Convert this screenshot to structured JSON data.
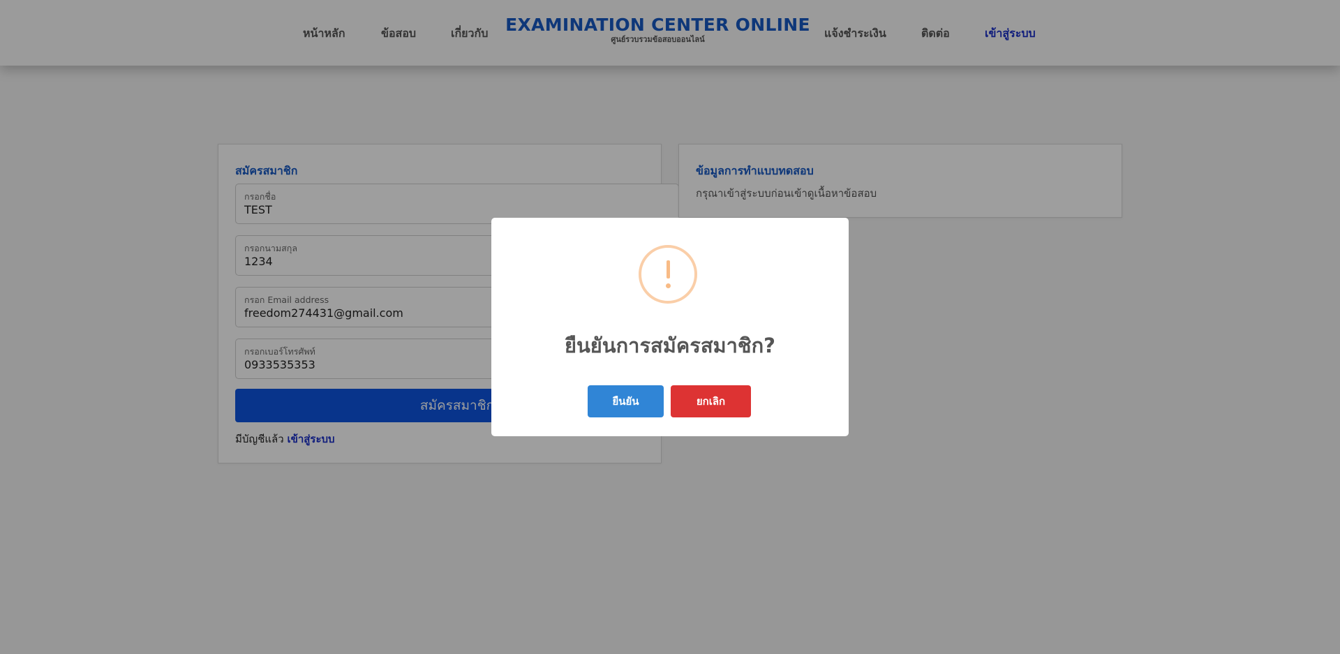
{
  "nav": {
    "items": [
      "หน้าหลัก",
      "ข้อสอบ",
      "เกี่ยวกับ",
      "แจ้งชำระเงิน",
      "ติดต่อ"
    ],
    "login": "เข้าสู่ระบบ"
  },
  "brand": {
    "title": "EXAMINATION CENTER ONLINE",
    "subtitle": "ศูนย์รวบรวมข้อสอบออนไลน์"
  },
  "register": {
    "title": "สมัครสมาชิก",
    "fields": [
      {
        "label": "กรอกชื่อ",
        "value": "TEST"
      },
      {
        "label": "กรอกนามสกุล",
        "value": "1234"
      },
      {
        "label": "กรอก Email address",
        "value": "freedom274431@gmail.com"
      },
      {
        "label": "กรอกเบอร์โทรศัพท์",
        "value": "0933535353"
      }
    ],
    "submit_label": "สมัครสมาชิก",
    "has_account_text": "มีบัญชีแล้ว",
    "login_link": "เข้าสู่ระบบ"
  },
  "info": {
    "title": "ข้อมูลการทำแบบทดสอบ",
    "text": "กรุณาเข้าสู่ระบบก่อนเข้าดูเนื้อหาข้อสอบ"
  },
  "modal": {
    "icon": "warning-icon",
    "title": "ยืนยันการสมัครสมาชิก?",
    "confirm_label": "ยืนยัน",
    "cancel_label": "ยกเลิก",
    "confirm_color": "#3085d6",
    "cancel_color": "#dd3333",
    "icon_color": "#f8bb86"
  },
  "colors": {
    "brand": "#1759c4",
    "primary_button": "#0d55e0",
    "link": "#1a2fc8"
  }
}
